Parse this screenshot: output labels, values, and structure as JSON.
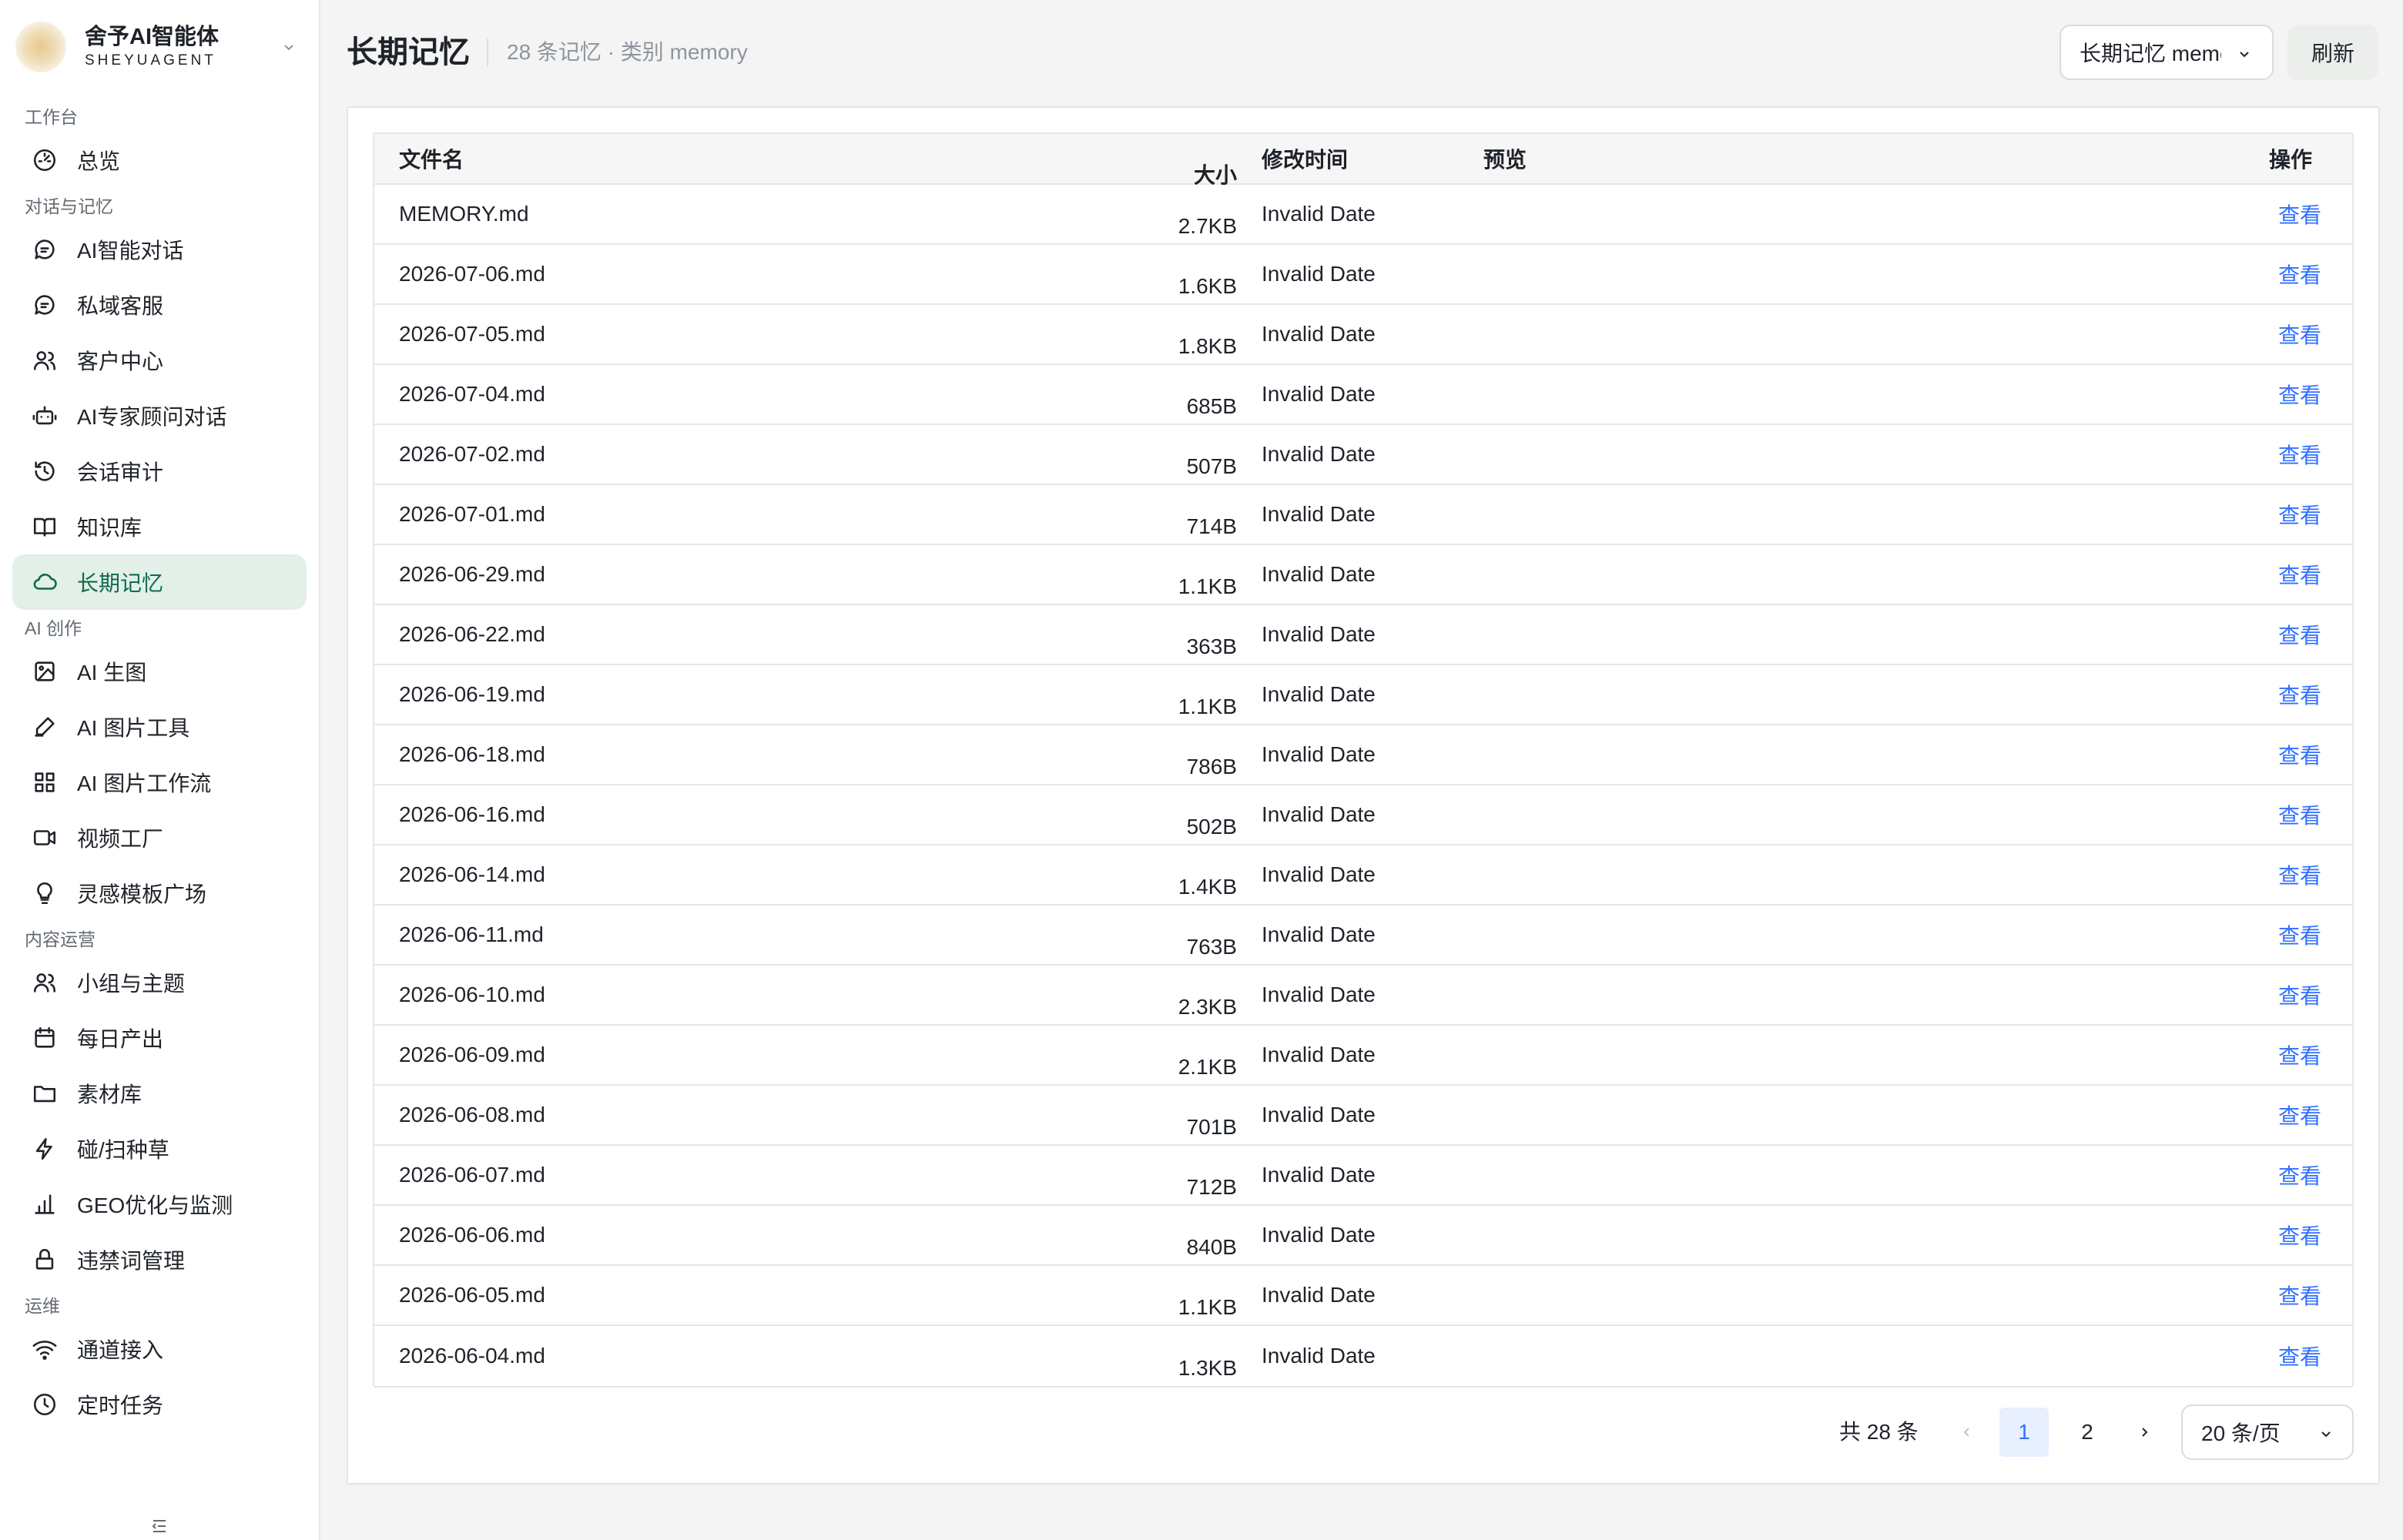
{
  "brand": {
    "name": "舍予AI智能体",
    "sub": "SHEYUAGENT"
  },
  "sidebar": {
    "groups": [
      {
        "label": "工作台",
        "items": [
          {
            "label": "总览",
            "icon": "dashboard-icon"
          }
        ]
      },
      {
        "label": "对话与记忆",
        "items": [
          {
            "label": "AI智能对话",
            "icon": "chat-bubble-icon"
          },
          {
            "label": "私域客服",
            "icon": "chat-bubble-icon"
          },
          {
            "label": "客户中心",
            "icon": "users-icon"
          },
          {
            "label": "AI专家顾问对话",
            "icon": "robot-icon"
          },
          {
            "label": "会话审计",
            "icon": "history-icon"
          },
          {
            "label": "知识库",
            "icon": "book-icon"
          },
          {
            "label": "长期记忆",
            "icon": "cloud-icon",
            "active": true
          }
        ]
      },
      {
        "label": "AI 创作",
        "items": [
          {
            "label": "AI 生图",
            "icon": "image-icon"
          },
          {
            "label": "AI 图片工具",
            "icon": "pen-icon"
          },
          {
            "label": "AI 图片工作流",
            "icon": "grid-icon"
          },
          {
            "label": "视频工厂",
            "icon": "video-icon"
          },
          {
            "label": "灵感模板广场",
            "icon": "bulb-icon"
          }
        ]
      },
      {
        "label": "内容运营",
        "items": [
          {
            "label": "小组与主题",
            "icon": "users-icon"
          },
          {
            "label": "每日产出",
            "icon": "calendar-icon"
          },
          {
            "label": "素材库",
            "icon": "folder-icon"
          },
          {
            "label": "碰/扫种草",
            "icon": "bolt-icon"
          },
          {
            "label": "GEO优化与监测",
            "icon": "bar-chart-icon"
          },
          {
            "label": "违禁词管理",
            "icon": "lock-icon"
          }
        ]
      },
      {
        "label": "运维",
        "items": [
          {
            "label": "通道接入",
            "icon": "wifi-icon"
          },
          {
            "label": "定时任务",
            "icon": "clock-icon"
          }
        ]
      }
    ]
  },
  "header": {
    "title": "长期记忆",
    "subtitle": "28 条记忆 · 类别 memory",
    "select_value": "长期记忆 memory",
    "refresh_label": "刷新"
  },
  "table": {
    "columns": {
      "name": "文件名",
      "size": "大小",
      "time": "修改时间",
      "preview": "预览",
      "op": "操作"
    },
    "action_label": "查看",
    "rows": [
      {
        "name": "MEMORY.md",
        "size": "2.7KB",
        "time": "Invalid Date",
        "preview": ""
      },
      {
        "name": "2026-07-06.md",
        "size": "1.6KB",
        "time": "Invalid Date",
        "preview": ""
      },
      {
        "name": "2026-07-05.md",
        "size": "1.8KB",
        "time": "Invalid Date",
        "preview": ""
      },
      {
        "name": "2026-07-04.md",
        "size": "685B",
        "time": "Invalid Date",
        "preview": ""
      },
      {
        "name": "2026-07-02.md",
        "size": "507B",
        "time": "Invalid Date",
        "preview": ""
      },
      {
        "name": "2026-07-01.md",
        "size": "714B",
        "time": "Invalid Date",
        "preview": ""
      },
      {
        "name": "2026-06-29.md",
        "size": "1.1KB",
        "time": "Invalid Date",
        "preview": ""
      },
      {
        "name": "2026-06-22.md",
        "size": "363B",
        "time": "Invalid Date",
        "preview": ""
      },
      {
        "name": "2026-06-19.md",
        "size": "1.1KB",
        "time": "Invalid Date",
        "preview": ""
      },
      {
        "name": "2026-06-18.md",
        "size": "786B",
        "time": "Invalid Date",
        "preview": ""
      },
      {
        "name": "2026-06-16.md",
        "size": "502B",
        "time": "Invalid Date",
        "preview": ""
      },
      {
        "name": "2026-06-14.md",
        "size": "1.4KB",
        "time": "Invalid Date",
        "preview": ""
      },
      {
        "name": "2026-06-11.md",
        "size": "763B",
        "time": "Invalid Date",
        "preview": ""
      },
      {
        "name": "2026-06-10.md",
        "size": "2.3KB",
        "time": "Invalid Date",
        "preview": ""
      },
      {
        "name": "2026-06-09.md",
        "size": "2.1KB",
        "time": "Invalid Date",
        "preview": ""
      },
      {
        "name": "2026-06-08.md",
        "size": "701B",
        "time": "Invalid Date",
        "preview": ""
      },
      {
        "name": "2026-06-07.md",
        "size": "712B",
        "time": "Invalid Date",
        "preview": ""
      },
      {
        "name": "2026-06-06.md",
        "size": "840B",
        "time": "Invalid Date",
        "preview": ""
      },
      {
        "name": "2026-06-05.md",
        "size": "1.1KB",
        "time": "Invalid Date",
        "preview": ""
      },
      {
        "name": "2026-06-04.md",
        "size": "1.3KB",
        "time": "Invalid Date",
        "preview": ""
      }
    ]
  },
  "pagination": {
    "total": "共 28 条",
    "pages": [
      "1",
      "2"
    ],
    "current": "1",
    "page_size": "20 条/页"
  },
  "colors": {
    "accent": "#0f6b4a",
    "active_bg": "#e3efe9",
    "link": "#3370ff"
  }
}
